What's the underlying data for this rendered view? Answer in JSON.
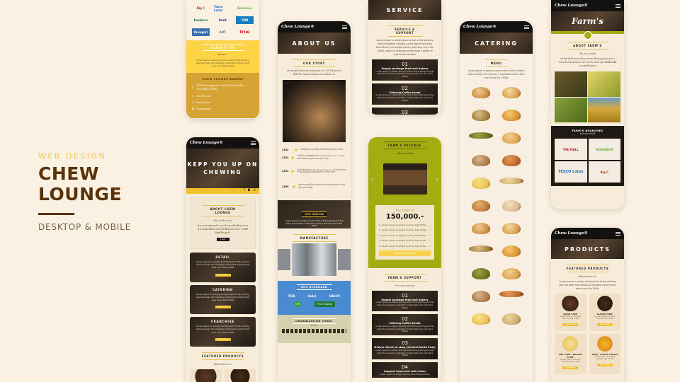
{
  "hero": {
    "kicker": "WEB DESIGN",
    "title_line1": "CHEW",
    "title_line2": "LOUNGE",
    "subtitle": "DESKTOP & MOBILE",
    "colors": {
      "accent": "#f3c94f",
      "brand": "#5a3108"
    }
  },
  "brand_logo": "Chew Lounge®",
  "phone_footer": {
    "partner_logos": [
      "Big C",
      "Tesco Lotus",
      "Robinson",
      "Kasikorn",
      "Bank",
      "TMB",
      "Krungsri",
      "AOT",
      "true"
    ],
    "contact_heading": "CONTACT US",
    "contact_sub": "ติดต่อเรา",
    "contact_text": "Lorem ipsum is simply dummy text of the printing and has been the industry's standard dummy text ever since the 1500s",
    "company_heading": "CHEW LOUNGE BAKERY",
    "address": "1946-48 ถนนสุขุมวิท ตำบลในเมือง อำเภอเมือง นครราชสีมา 30000",
    "phone": "044 201 143",
    "facebook": "ChewLounge",
    "instagram": "ChewLounge"
  },
  "phone_home": {
    "hero_text": "KEPP YOU UP ON CHEWING",
    "about_heading": "ABOUT CHEW LOUNGE",
    "about_sub": "เกี่ยวกับ ชิวเลานจ์",
    "about_text": "ชิวเลานจ์ ผลิตขนมปัง เบเกอรี่ และเครื่องดื่มคุณภาพ ด้วยวัตถุดิบที่คัดสรรอย่างดี เพื่อมอบประสบการณ์ที่ดีที่สุดให้กับลูกค้า",
    "about_button": "อ่านต่อ",
    "cards": [
      {
        "title": "RETAIL",
        "text": "Lorem ipsum is simply dummy text of the printing and has been the industry's standard dummy text ever since the 1500s",
        "button": "ดูรายละเอียด"
      },
      {
        "title": "CATERING",
        "text": "Lorem ipsum is simply dummy text of the printing and has been the industry's standard dummy text ever since the 1500s",
        "button": "ดูรายละเอียด"
      },
      {
        "title": "FRANCHISE",
        "text": "Lorem ipsum is simply dummy text of the printing and has been the industry's standard dummy text ever since the 1500s",
        "button": "ดูรายละเอียด"
      }
    ],
    "featured_heading": "FEATURED PRODUCTS",
    "featured_sub": "ผลิตภัณฑ์แนะนำ"
  },
  "phone_about": {
    "banner": "ABOUT US",
    "story_heading": "OUR STORY",
    "story_text": "เชิวเลานจ์เริ่มต้นจากธุรกิจครอบครัวกว่า 30 ปี ด้วยความตั้งใจในการผลิตขนมปังและเบเกอรี่คุณภาพ",
    "timeline": [
      {
        "year": "2532",
        "text": "เริ่มต้นธุรกิจเบเกอรี่ขนาดเล็กในจังหวัดนครราชสีมา"
      },
      {
        "year": "2542",
        "text": "ก่อตั้งโรงงานผลิตขนมปัง (Sweet Foods corp. co.ltd) ผลิตขนมปังบรรจุห่อ package bread"
      },
      {
        "year": "2553",
        "text": "ก่อตั้งบริษัท ชิวเลานจ์ (chew lounge co.ltd) ขยายสาขาร้านเบเกอรี่ในห้างสรรพสินค้ากว่า 500 สาขา"
      },
      {
        "year": "2560",
        "text": "เปิดตัวแบรนด์ใหม่ FARM'S ร้านเบเกอรี่ครบวงจร พร้อมบริการแฟรนไชส์"
      }
    ],
    "mission_heading": "OUR MISSION",
    "mission_text": "Lorem ipsum is simply dummy text of the printing and has been the industry's standard dummy text ever since the 1500s",
    "manufacture_heading": "MANUFACTURE",
    "standard_heading": "OUR STANDARD",
    "standard_logos": [
      "FDA",
      "Halal",
      "HACCP",
      "GMP",
      "Thai Quality"
    ],
    "org_heading": "ORGANIZATION CHART",
    "org_sub": "ผังองค์กร"
  },
  "phone_service": {
    "banner": "SERVICE",
    "heading": "SERVICE & SUPPORT",
    "text": "Lorem ipsum is simply dummy text of the printing and typesetting industry. Lorem Ipsum has been the industry's standard dummy text ever since the 1500s, when an unknown printer took a galley of type and scrambled",
    "items": [
      {
        "num": "01",
        "title": "Supply package food and bakery",
        "text": "Lorem ipsum is simply dummy text of the printing and has been the industry's standard dummy text ever since the 1500s"
      },
      {
        "num": "02",
        "title": "Catering Coffee break",
        "text": "Lorem ipsum is simply dummy text of the printing and has been the industry's standard dummy text ever since the 1500s"
      },
      {
        "num": "03",
        "title": "",
        "text": ""
      }
    ]
  },
  "phone_package": {
    "heading": "FARM'S PACKAGE",
    "sub": "แพ็คเกจฟาร์มส์",
    "package_name": "Package B",
    "price": "150,000.-",
    "features": [
      "1. Lorem ipsum is simply dummy text of the",
      "2. Lorem ipsum is simply dummy text of the",
      "3. Lorem ipsum is simply dummy text of the",
      "4. Lorem ipsum is simply dummy text of the",
      "5. Lorem ipsum is simply dummy text of the"
    ],
    "button": "ติดต่อสอบถามเพิ่มเติม",
    "support_heading": "FARM'S SUPPORT",
    "support_sub": "บริการของ ฟาร์มส์",
    "support_items": [
      {
        "num": "01",
        "title": "Supply package food and bakery",
        "text": "Lorem ipsum is simply dummy text of the printing and has been the industry's standard dummy text ever since the 1500s"
      },
      {
        "num": "02",
        "title": "Catering Coffee break",
        "text": "Lorem ipsum is simply dummy text of the printing and has been the industry's standard dummy text ever since the 1500s"
      },
      {
        "num": "03",
        "title": "Deliver direct to shop (Central-North East)",
        "text": "Lorem ipsum is simply dummy text of the printing and has been the industry's standard dummy text ever since the 1500s"
      },
      {
        "num": "04",
        "title": "Support team and call center",
        "text": "Lorem ipsum is simply dummy text of the printing"
      }
    ],
    "colors": {
      "olive": "#a3ad12"
    }
  },
  "phone_catering": {
    "banner": "CATERING",
    "menu_heading": "MENU",
    "menu_text": "Lorem ipsum is simply dummy text of the printing and has been the industry's standard dummy text ever since the 1500s",
    "bread_count": 22
  },
  "phone_farms": {
    "banner_logo": "Farm's",
    "about_heading": "ABOUT FARM'S",
    "about_sub": "เกี่ยวกับ ฟาร์มส์",
    "about_text": "ฟาร์มส์ เป็นร้านเบเกอรี่และกาแฟ พร้อมเมนูอาหารหลากหลาย ด้วยวัตถุดิบคุณภาพจากฟาร์ม คัดสรรอย่างพิถีพิถันเพื่อความสดใหม่ทุกวัน",
    "branches_heading": "FARM'S BRANCHES",
    "branches_sub": "สาขาของ ฟาร์มส์",
    "branches": [
      "THE MALL",
      "ROBINSON",
      "TESCO Lotus",
      "Big C"
    ]
  },
  "phone_products": {
    "banner": "PRODUCTS",
    "heading": "FEATURED PRODUCTS",
    "sub": "ผลิตภัณฑ์แนะนำ",
    "text": "Lorem ipsum is simply dummy text of the printing and has been the industry's standard dummy text ever since the 1500s",
    "items": [
      {
        "name": "ROND CAKE",
        "desc": "Lorem ipsum is simply dummy text of the",
        "button": "ดูรายละเอียด"
      },
      {
        "name": "SLICED CAKE",
        "desc": "Lorem ipsum is simply dummy text of the",
        "button": "ดูรายละเอียด"
      },
      {
        "name": "CUP CAKE / ROLLED CAKE",
        "desc": "Lorem ipsum is simply dummy text of the",
        "button": "ดูรายละเอียด"
      },
      {
        "name": "TART / CHOUX CREAM",
        "desc": "Lorem ipsum is simply dummy text of the",
        "button": "ดูรายละเอียด"
      }
    ]
  }
}
